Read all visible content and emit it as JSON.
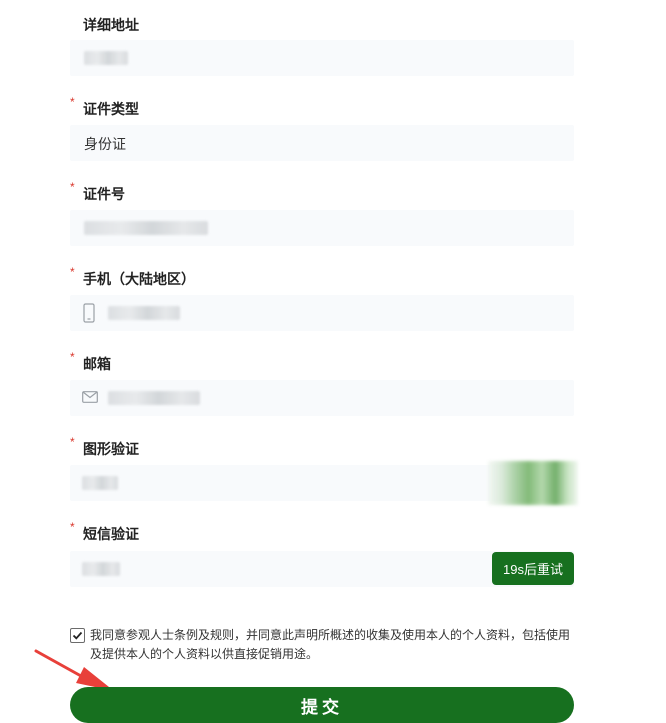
{
  "form": {
    "address": {
      "label": "详细地址",
      "required": false
    },
    "id_type": {
      "label": "证件类型",
      "required": true,
      "value": "身份证"
    },
    "id_number": {
      "label": "证件号",
      "required": true
    },
    "mobile": {
      "label": "手机（大陆地区）",
      "required": true
    },
    "email": {
      "label": "邮箱",
      "required": true
    },
    "captcha": {
      "label": "图形验证",
      "required": true
    },
    "sms": {
      "label": "短信验证",
      "required": true,
      "button_label": "19s后重试"
    },
    "required_mark": "*"
  },
  "agreement": {
    "checked": true,
    "text": "我同意参观人士条例及规则，并同意此声明所概述的收集及使用本人的个人资料，包括使用及提供本人的个人资料以供直接促销用途。"
  },
  "submit_label": "提交",
  "colors": {
    "primary": "#17701f",
    "required": "#d9362b",
    "input_bg": "#f8fafc",
    "annotation_arrow": "#e8403a"
  },
  "icons": {
    "mobile": "phone-icon",
    "email": "mail-icon",
    "checkbox": "check-icon",
    "annotation": "arrow-icon"
  }
}
